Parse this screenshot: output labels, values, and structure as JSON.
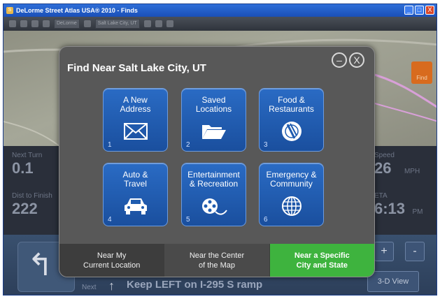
{
  "window": {
    "title": "DeLorme Street Atlas USA® 2010 - Finds",
    "controls": [
      "_",
      "□",
      "X"
    ]
  },
  "toolbar": {
    "select1": "DeLorme",
    "select2": "Salt Lake City, UT"
  },
  "map": {
    "find_tab_label": "Find"
  },
  "dashboard": {
    "next_turn_label": "Next Turn",
    "next_turn_value": "0.1",
    "dist_label": "Dist to Finish",
    "dist_value": "222",
    "speed_label": "Speed",
    "speed_value": "26",
    "speed_unit": "MPH",
    "eta_label": "ETA",
    "eta_value": "6:13",
    "eta_unit": "PM"
  },
  "bottom": {
    "next_label": "Next",
    "next_instruction": "Keep LEFT on I-295 S ramp",
    "zoom_in": "+",
    "zoom_out": "-",
    "view3d": "3-D View"
  },
  "modal": {
    "title": "Find Near Salt Lake City, UT",
    "minimize_symbol": "–",
    "close_symbol": "X",
    "tiles": [
      {
        "label": "A New\nAddress",
        "number": "1",
        "icon": "envelope-icon"
      },
      {
        "label": "Saved\nLocations",
        "number": "2",
        "icon": "folder-icon"
      },
      {
        "label": "Food &\nRestaurants",
        "number": "3",
        "icon": "plate-icon"
      },
      {
        "label": "Auto &\nTravel",
        "number": "4",
        "icon": "car-icon"
      },
      {
        "label": "Entertainment\n& Recreation",
        "number": "5",
        "icon": "film-reel-icon"
      },
      {
        "label": "Emergency &\nCommunity",
        "number": "6",
        "icon": "globe-icon"
      }
    ],
    "footer": [
      {
        "label": "Near My\nCurrent Location",
        "selected": false
      },
      {
        "label": "Near the Center\nof the Map",
        "selected": false
      },
      {
        "label": "Near a Specific\nCity and State",
        "selected": true
      }
    ]
  },
  "colors": {
    "tile_blue": "#1f5cb0",
    "active_green": "#3eb33e",
    "modal_bg": "#585858"
  }
}
